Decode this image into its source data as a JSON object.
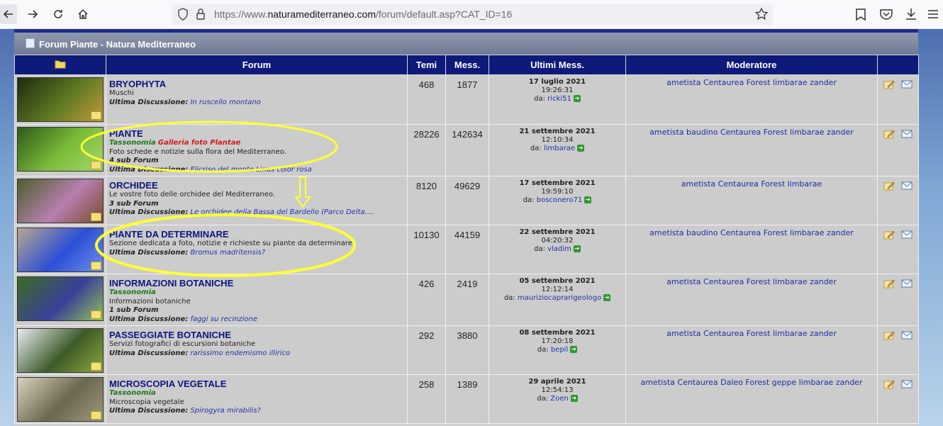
{
  "browser": {
    "url_prefix": "https://www.",
    "url_host": "naturamediterraneo.com",
    "url_path": "/forum/default.asp?CAT_ID=16"
  },
  "category": {
    "title": "Forum Piante - Natura Mediterraneo"
  },
  "table": {
    "headers": {
      "forum": "Forum",
      "topics": "Temi",
      "messages": "Mess.",
      "last": "Ultimi Mess.",
      "moderator": "Moderatore"
    },
    "last_discussion_label": "Ultima Discussione:",
    "by_label": "da:",
    "rows": [
      {
        "name": "BRYOPHYTA",
        "desc": "Muschi",
        "last_topic": "In ruscello montano",
        "topics": "468",
        "messages": "1877",
        "last_date": "17 luglio 2021",
        "last_time": "19:26:31",
        "last_user": "ricki51",
        "moderators": "ametista Centaurea Forest limbarae zander",
        "thumb_colors": [
          "#1d2b0f",
          "#5e7a23",
          "#c49a3c"
        ]
      },
      {
        "name": "PIANTE",
        "taxonomy": "Tassonomia",
        "gallery": "Galleria foto Plantae",
        "desc": "Foto schede e notizie sulla flora del Mediterraneo.",
        "subforums": "4 sub Forum",
        "last_topic": "Elicriso del monte Linas color rosa",
        "topics": "28226",
        "messages": "142634",
        "last_date": "21 settembre 2021",
        "last_time": "12:10:34",
        "last_user": "limbarae",
        "moderators": "ametista baudino Centaurea Forest limbarae zander",
        "thumb_colors": [
          "#2f5a18",
          "#7bbd3a",
          "#a7d66b"
        ]
      },
      {
        "name": "ORCHIDEE",
        "desc": "Le vostre foto delle orchidee del Mediterraneo.",
        "subforums": "3 sub Forum",
        "last_topic": "Le orchidee della Bassa del Bardello (Parco Delta....",
        "topics": "8120",
        "messages": "49629",
        "last_date": "17 settembre 2021",
        "last_time": "19:59:10",
        "last_user": "bosconero71",
        "moderators": "ametista Centaurea Forest limbarae",
        "thumb_colors": [
          "#4e5f2a",
          "#b77fb0",
          "#7a4a2a"
        ]
      },
      {
        "name": "PIANTE DA DETERMINARE",
        "desc": "Sezione dedicata a foto, notizie e richieste su piante da determinare",
        "last_topic": "Bromus madritensis?",
        "topics": "10130",
        "messages": "44159",
        "last_date": "22 settembre 2021",
        "last_time": "04:20:32",
        "last_user": "vladim",
        "moderators": "ametista baudino Centaurea Forest limbarae zander",
        "thumb_colors": [
          "#b9a690",
          "#2b4fd6",
          "#6f8ee8"
        ]
      },
      {
        "name": "INFORMAZIONI BOTANICHE",
        "taxonomy": "Tassonomia",
        "desc": "Informazioni botaniche",
        "subforums": "1 sub Forum",
        "last_topic": "faggi su recinzione",
        "topics": "426",
        "messages": "2419",
        "last_date": "05 settembre 2021",
        "last_time": "12:12:14",
        "last_user": "mauriziocaprarigeologo",
        "moderators": "ametista Centaurea Forest limbarae zander",
        "thumb_colors": [
          "#3d6b22",
          "#3a3f9a",
          "#8fc25a"
        ]
      },
      {
        "name": "PASSEGGIATE BOTANICHE",
        "desc": "Servizi fotografici di escursioni botaniche",
        "last_topic": "rarissimo endemismo illirico",
        "topics": "292",
        "messages": "3880",
        "last_date": "08 settembre 2021",
        "last_time": "17:20:18",
        "last_user": "bepil",
        "moderators": "ametista Centaurea Forest limbarae zander",
        "thumb_colors": [
          "#e8ecef",
          "#3e5a2a",
          "#8aa83e"
        ]
      },
      {
        "name": "MICROSCOPIA VEGETALE",
        "taxonomy": "Tassonomia",
        "desc": "Microscopia vegetale",
        "last_topic": "Spirogyra mirabilis?",
        "topics": "258",
        "messages": "1389",
        "last_date": "29 aprile 2021",
        "last_time": "12:54:13",
        "last_user": "Zoen",
        "moderators": "ametista Centaurea Daleo Forest geppe limbarae zander",
        "thumb_colors": [
          "#d8d2b8",
          "#6b6650",
          "#9f9a7c"
        ]
      }
    ]
  },
  "colors": {
    "header_bg": "#0e1a7a",
    "row_bg": "#cccccc",
    "forum_link": "#0c1580",
    "annotation": "#ffff33"
  }
}
